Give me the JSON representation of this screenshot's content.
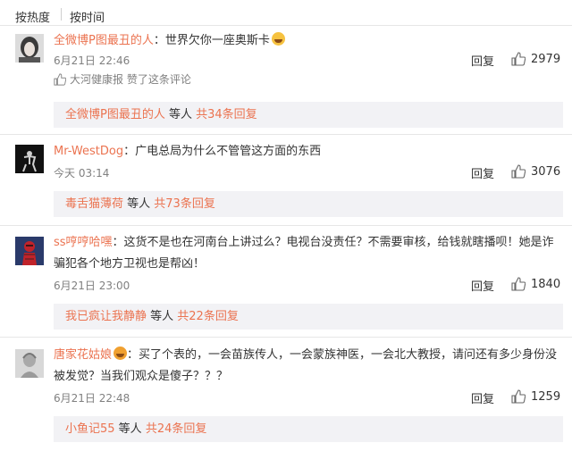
{
  "sort": {
    "hot": "按热度",
    "time": "按时间"
  },
  "comments": [
    {
      "user": "全微博P图最丑的人",
      "text": "：世界欠你一座奥斯卡",
      "emoji": "laugh-cry-emoji",
      "time": "6月21日 22:46",
      "reply": "回复",
      "likes": "2979",
      "liked_by": "大河健康报 赞了这条评论",
      "sub_user": "全微博P图最丑的人",
      "sub_mid": " 等人 ",
      "sub_more": "共34条回复"
    },
    {
      "user": "Mr-WestDog",
      "text": "：广电总局为什么不管管这方面的东西",
      "time": "今天 03:14",
      "reply": "回复",
      "likes": "3076",
      "sub_user": "毒舌猫薄荷",
      "sub_mid": " 等人 ",
      "sub_more": "共73条回复"
    },
    {
      "user": "ss哼哼哈嘿",
      "text": "：这货不是也在河南台上讲过么？电视台没责任？不需要审核，给钱就瞎播呗！她是诈骗犯各个地方卫视也是帮凶！",
      "time": "6月21日 23:00",
      "reply": "回复",
      "likes": "1840",
      "sub_user": "我已疯让我静静",
      "sub_mid": " 等人 ",
      "sub_more": "共22条回复"
    },
    {
      "user": "唐家花姑娘",
      "text": "：买了个表的，一会苗族传人，一会蒙族神医，一会北大教授，请问还有多少身份没被发觉？当我们观众是傻子？？？",
      "time": "6月21日 22:48",
      "reply": "回复",
      "likes": "1259",
      "sub_user": "小鱼记55",
      "sub_mid": " 等人 ",
      "sub_more": "共24条回复"
    }
  ],
  "colors": {
    "accent": "#eb7350",
    "meta": "#808080",
    "subbox": "#f2f2f5"
  }
}
